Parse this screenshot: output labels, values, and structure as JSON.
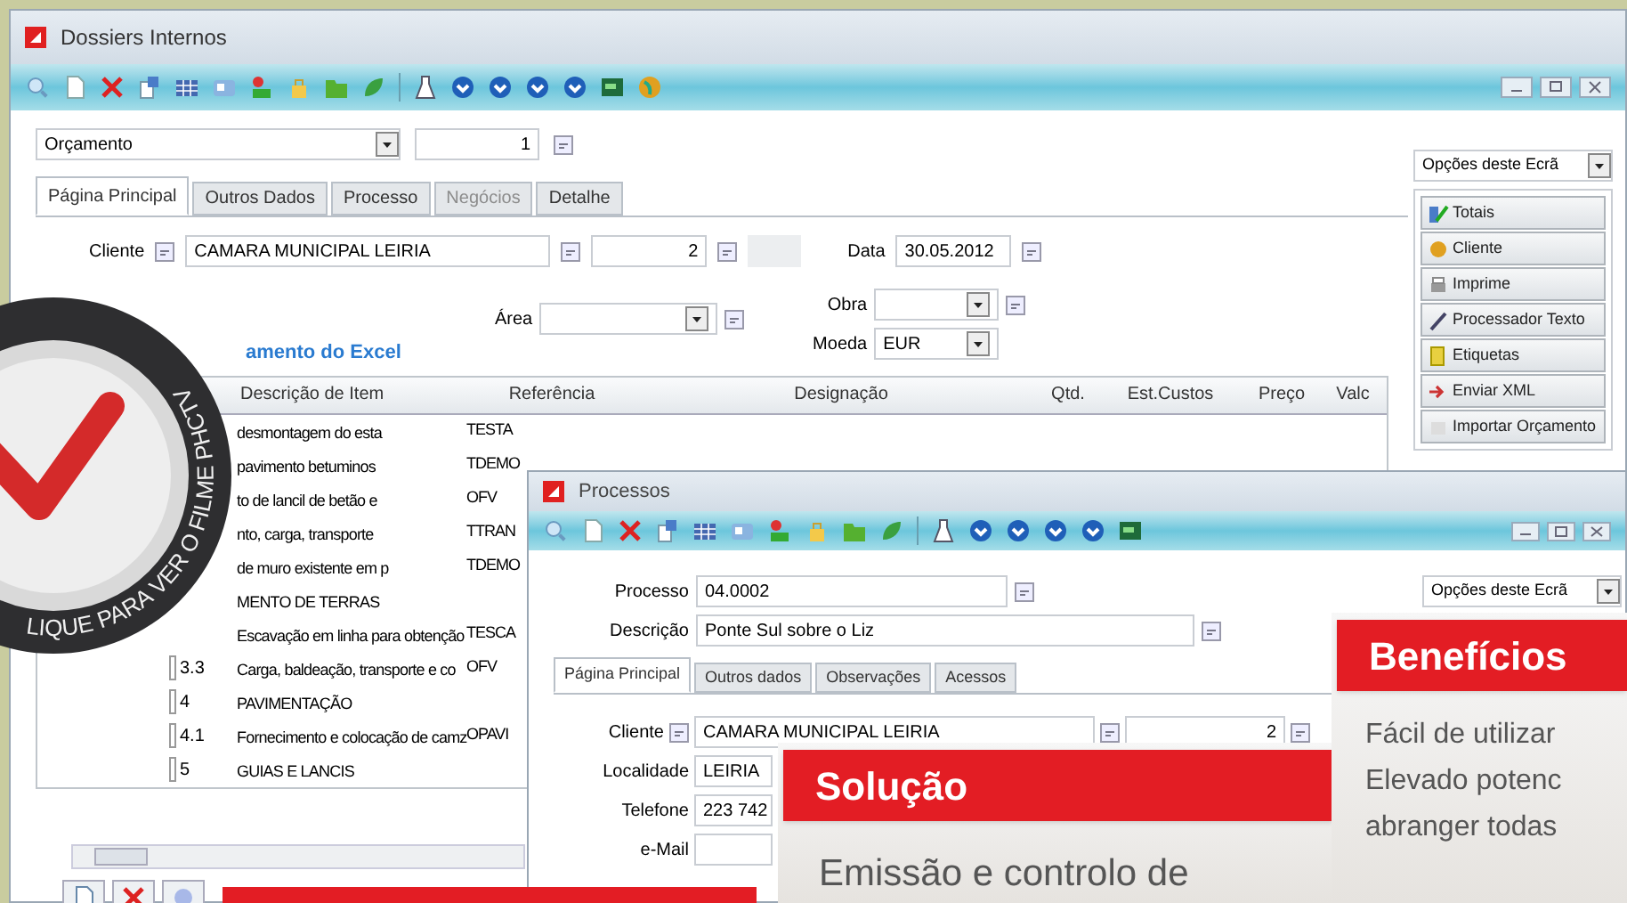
{
  "main_window": {
    "title": "Dossiers Internos",
    "document_type": "Orçamento",
    "number": "1",
    "tabs": [
      {
        "label": "Página Principal",
        "selected": true,
        "disabled": false
      },
      {
        "label": "Outros Dados",
        "selected": false,
        "disabled": false
      },
      {
        "label": "Processo",
        "selected": false,
        "disabled": false
      },
      {
        "label": "Negócios",
        "selected": false,
        "disabled": true
      },
      {
        "label": "Detalhe",
        "selected": false,
        "disabled": false
      }
    ],
    "client_label": "Cliente",
    "client": "CAMARA MUNICIPAL LEIRIA",
    "client_number": "2",
    "date_label": "Data",
    "date": "30.05.2012",
    "area_label": "Área",
    "work_label": "Obra",
    "currency_label": "Moeda",
    "currency": "EUR",
    "excel_link": "amento do Excel",
    "table": {
      "columns": [
        "Descrição de Item",
        "Referência",
        "Designação",
        "Qtd.",
        "Est.Custos",
        "Preço",
        "Valc"
      ],
      "rows": [
        {
          "description": "desmontagem do esta",
          "reference": "TESTA"
        },
        {
          "description": "pavimento betuminos",
          "reference": "TDEMO"
        },
        {
          "description": "to de lancil de betão e",
          "reference": "OFV"
        },
        {
          "description": "nto, carga, transporte",
          "reference": "TTRAN"
        },
        {
          "description": "de muro existente em p",
          "reference": "TDEMO"
        },
        {
          "description": "MENTO DE TERRAS"
        },
        {
          "description": "Escavação em linha para obtenção",
          "reference": "TESCA"
        },
        {
          "number": "3.3",
          "description": "Carga, baldeação, transporte e co",
          "reference": "OFV"
        },
        {
          "number": "4",
          "description": "PAVIMENTAÇÃO"
        },
        {
          "number": "4.1",
          "description": "Fornecimento e colocação de camz",
          "reference": "OPAVI"
        },
        {
          "number": "5",
          "description": "GUIAS E LANCIS"
        }
      ]
    },
    "options": {
      "label": "Opções deste Ecrã",
      "buttons": [
        "Totais",
        "Cliente",
        "Imprime",
        "Processador Texto",
        "Etiquetas",
        "Enviar XML",
        "Importar Orçamento"
      ]
    }
  },
  "process_window": {
    "title": "Processos",
    "process_label": "Processo",
    "process": "04.0002",
    "description_label": "Descrição",
    "description": "Ponte Sul sobre o Liz",
    "options_label": "Opções deste Ecrã",
    "tabs": [
      {
        "label": "Página Principal",
        "selected": true
      },
      {
        "label": "Outros dados",
        "selected": false
      },
      {
        "label": "Observações",
        "selected": false
      },
      {
        "label": "Acessos",
        "selected": false
      }
    ],
    "client_label": "Cliente",
    "client": "CAMARA MUNICIPAL LEIRIA",
    "client_number": "2",
    "locality_label": "Localidade",
    "locality": "LEIRIA",
    "phone_label": "Telefone",
    "phone": "223 742",
    "email_label": "e-Mail"
  },
  "video_badge": {
    "text": "LIQUE PARA VER O FILME PHCTV"
  },
  "cards": [
    {
      "title": "Solução",
      "lines": [
        "Emissão e controlo de"
      ]
    },
    {
      "title": "Benefícios",
      "lines": [
        "Fácil de utilizar",
        "Elevado potenc",
        "abranger todas"
      ]
    }
  ]
}
